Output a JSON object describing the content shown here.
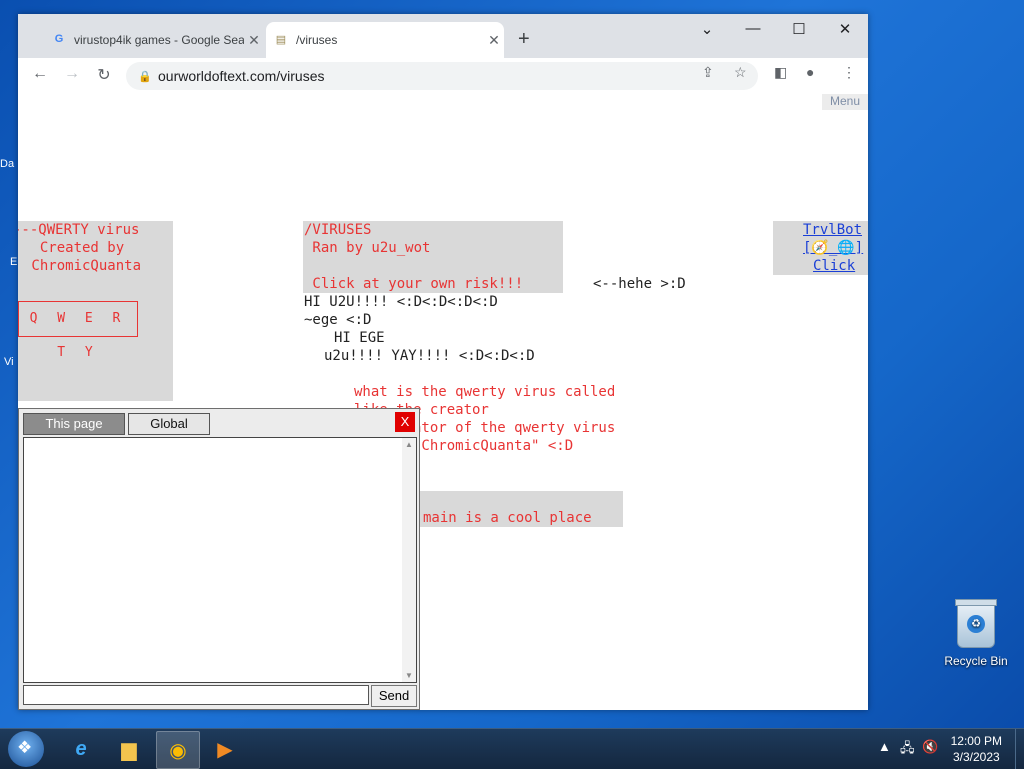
{
  "browser": {
    "tabs": [
      {
        "title": "virustop4ik games - Google Sear",
        "icon": "google-icon",
        "active": false
      },
      {
        "title": "/viruses",
        "icon": "scroll-icon",
        "active": true
      }
    ],
    "url": "ourworldoftext.com/viruses"
  },
  "page": {
    "menu_label": "Menu",
    "qwerty_cell": {
      "lines": [
        "---QWERTY virus",
        "  Created by",
        " ChromicQuanta"
      ],
      "box_text": "Q W E R T Y"
    },
    "viruses_cell": {
      "lines": [
        "/VIRUSES",
        " Ran by u2u_wot",
        "",
        " Click at your own risk!!!"
      ]
    },
    "trvlbot": {
      "line1": "TrvlBot",
      "line2": "[🧭_🌐]",
      "line3": "Click"
    },
    "chat_text": [
      {
        "text": "<--hehe >:D",
        "color": "black"
      },
      {
        "text": "HI U2U!!!! <:D<:D<:D<:D",
        "color": "black"
      },
      {
        "text": "~ege <:D",
        "color": "black"
      },
      {
        "text": "HI EGE",
        "color": "black"
      },
      {
        "text": "u2u!!!! YAY!!!! <:D<:D<:D",
        "color": "black"
      },
      {
        "text": "what is the qwerty virus called",
        "color": "red"
      },
      {
        "text": "like the creator",
        "color": "red"
      },
      {
        "text": "the creator of the qwerty virus",
        "color": "red"
      },
      {
        "text": "called \"ChromicQuanta\" <:D",
        "color": "red"
      },
      {
        "text": "main is a cool place",
        "color": "red"
      }
    ]
  },
  "chat": {
    "tab_this_page": "This page",
    "tab_global": "Global",
    "close_label": "X",
    "send_label": "Send",
    "input_value": ""
  },
  "desktop": {
    "recycle_bin_label": "Recycle Bin",
    "left_fragments": [
      "Da",
      "E",
      "Vi"
    ]
  },
  "taskbar": {
    "time": "12:00 PM",
    "date": "3/3/2023"
  }
}
